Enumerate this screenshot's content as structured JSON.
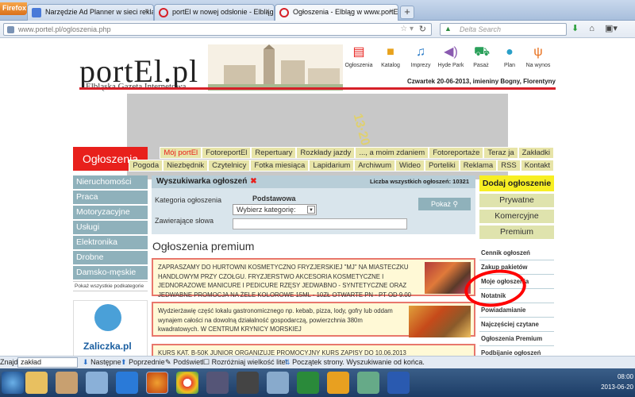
{
  "browser": {
    "app_button": "Firefox",
    "tabs": [
      {
        "label": "Narzędzie Ad Planner w sieci reklamo..."
      },
      {
        "label": "portEl w nowej odsłonie - Elbląg w w..."
      },
      {
        "label": "Ogłoszenia - Elbląg w www.portEl.pl"
      }
    ],
    "new_tab": "+",
    "url_host": "www.portel.pl",
    "url_path": "/ogloszenia.php",
    "search_placeholder": "Delta Search"
  },
  "site": {
    "logo_main": "portEl.pl",
    "logo_sub": "Elbląska Gazeta Internetowa",
    "date_line": "Czwartek 20-06-2013, imieniny Bogny, Florentyny",
    "top_icons": [
      {
        "label": "Ogłoszenia",
        "icon": "newspaper-icon",
        "color": "#e8201c"
      },
      {
        "label": "Katalog",
        "icon": "briefcase-icon",
        "color": "#e8a21c"
      },
      {
        "label": "Imprezy",
        "icon": "music-note-icon",
        "color": "#2a7bc8"
      },
      {
        "label": "Hyde Park",
        "icon": "speaker-icon",
        "color": "#8a5ab0"
      },
      {
        "label": "Pasaż",
        "icon": "cart-icon",
        "color": "#2aa05a"
      },
      {
        "label": "Plan",
        "icon": "map-pin-icon",
        "color": "#2a9fc8"
      },
      {
        "label": "Na wynos",
        "icon": "fork-knife-icon",
        "color": "#e8701c"
      }
    ]
  },
  "menu": {
    "section_title": "Ogłoszenia",
    "row1": [
      "Mój portEl",
      "FotoreportEl",
      "Repertuary",
      "Rozkłady jazdy",
      "..., a moim zdaniem",
      "Fotoreportaże",
      "Teraz ja",
      "Zakładki"
    ],
    "row2": [
      "Pogoda",
      "Niezbędnik",
      "Czytelnicy",
      "Fotka miesiąca",
      "Lapidarium",
      "Archiwum",
      "Wideo",
      "Porteliki",
      "Reklama",
      "RSS",
      "Kontakt"
    ]
  },
  "left_nav": {
    "items": [
      "Nieruchomości",
      "Praca",
      "Motoryzacyjne",
      "Usługi",
      "Elektronika",
      "Drobne",
      "Damsko-męskie"
    ],
    "show_all": "Pokaż wszystkie podkategorie",
    "promo": "Zaliczka.pl"
  },
  "search_box": {
    "title": "Wyszukiwarka ogłoszeń",
    "count_label": "Liczba wszystkich ogłoszeń: 10321",
    "category_label": "Kategoria ogłoszenia",
    "category_type": "Podstawowa",
    "category_select": "Wybierz kategorię:",
    "keywords_label": "Zawierające słowa",
    "keywords_value": "",
    "show_button": "Pokaż"
  },
  "premium": {
    "title": "Ogłoszenia premium",
    "ads": [
      {
        "text": "ZAPRASZAMY DO HURTOWNI KOSMETYCZNO FRYZJERSKIEJ \"MJ\" NA MIASTECZKU HANDLOWYM PRZY CZOŁGU. FRYZJERSTWO AKCESORIA KOSMETYCZNE I JEDNORAZOWE MANICURE I PEDICURE RZĘSY JEDWABNO - SYNTETYCZNE ORAZ JEDWABNE PROMOCJA NA ŻELE KOLOROWE 15ML - 10ZŁ OTWARTE PN - PT OD 9.00"
      },
      {
        "text": "Wydzierżawię część lokalu gastronomicznego np. kebab, pizza, lody, gofry lub oddam wynajem całości na dowolną działalność gospodarczą, powierzchnia 380m kwadratowych. W CENTRUM KRYNICY MORSKIEJ"
      },
      {
        "text": "KURS KAT. B-50K JUNIOR ORGANIZUJE PROMOCYJNY KURS ZAPISY DO 10.06.2013"
      }
    ]
  },
  "right_col": {
    "add_button": "Dodaj ogłoszenie",
    "types": [
      "Prywatne",
      "Komercyjne",
      "Premium"
    ],
    "links": [
      "Cennik ogłoszeń",
      "Zakup pakietów",
      "Moje ogłoszenia",
      "Notatnik",
      "Powiadamianie",
      "Najczęściej czytane",
      "Ogłoszenia Premium",
      "Podbijanie ogłoszeń"
    ]
  },
  "findbar": {
    "label": "Znajdź:",
    "value": "zakład",
    "next": "Następne",
    "prev": "Poprzednie",
    "highlight": "Podświetl",
    "match_case": "Rozróżniaj wielkość liter",
    "status": "Początek strony. Wyszukiwanie od końca."
  },
  "taskbar": {
    "time": "08:00",
    "date": "2013-06-20"
  }
}
